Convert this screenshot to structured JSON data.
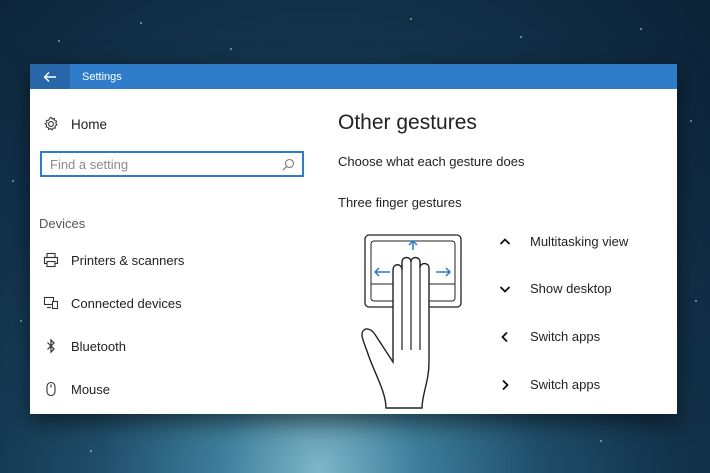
{
  "window": {
    "title": "Settings"
  },
  "sidebar": {
    "home_label": "Home",
    "search_placeholder": "Find a setting",
    "section_label": "Devices",
    "items": [
      {
        "label": "Printers & scanners",
        "icon": "printer-icon"
      },
      {
        "label": "Connected devices",
        "icon": "connected-devices-icon"
      },
      {
        "label": "Bluetooth",
        "icon": "bluetooth-icon"
      },
      {
        "label": "Mouse",
        "icon": "mouse-icon"
      }
    ]
  },
  "main": {
    "heading": "Other gestures",
    "subtext": "Choose what each gesture does",
    "group_label": "Three finger gestures",
    "gestures": [
      {
        "direction": "up",
        "icon": "chevron-up-icon",
        "label": "Multitasking view"
      },
      {
        "direction": "down",
        "icon": "chevron-down-icon",
        "label": "Show desktop"
      },
      {
        "direction": "left",
        "icon": "chevron-left-icon",
        "label": "Switch apps"
      },
      {
        "direction": "right",
        "icon": "chevron-right-icon",
        "label": "Switch apps"
      }
    ]
  },
  "colors": {
    "accent": "#2f7ccb",
    "titlebar": "#2f7ccb",
    "arrow": "#2b7bd0"
  }
}
